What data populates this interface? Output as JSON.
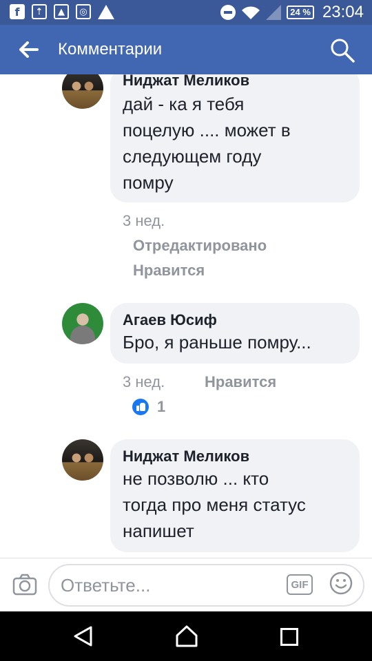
{
  "status_bar": {
    "battery": "24 %",
    "time": "23:04"
  },
  "app_bar": {
    "title": "Комментарии",
    "back_icon": "arrow-left-icon",
    "search_icon": "search-icon"
  },
  "comments": [
    {
      "author": "Ниджат Меликов",
      "lines": [
        "дай - ка  я тебя",
        "поцелую .... может в",
        "следующем году",
        "помру"
      ],
      "time": "3 нед.",
      "edited": "Отредактировано",
      "like": "Нравится"
    },
    {
      "author": "Агаев Юсиф",
      "lines": [
        "Бро, я раньше помру..."
      ],
      "time": "3 нед.",
      "like": "Нравится",
      "reactions": "1"
    },
    {
      "author": "Ниджат Меликов",
      "lines": [
        "не позволю ... кто",
        "тогда про меня статус",
        "напишет"
      ]
    }
  ],
  "reply_bar": {
    "placeholder": "Ответьте...",
    "gif_label": "GIF"
  },
  "colors": {
    "status_bar": "#3b5998",
    "app_bar": "#4267b2",
    "bubble": "#f1f2f6",
    "meta_text": "#90949c",
    "like_blue": "#1877f2"
  }
}
